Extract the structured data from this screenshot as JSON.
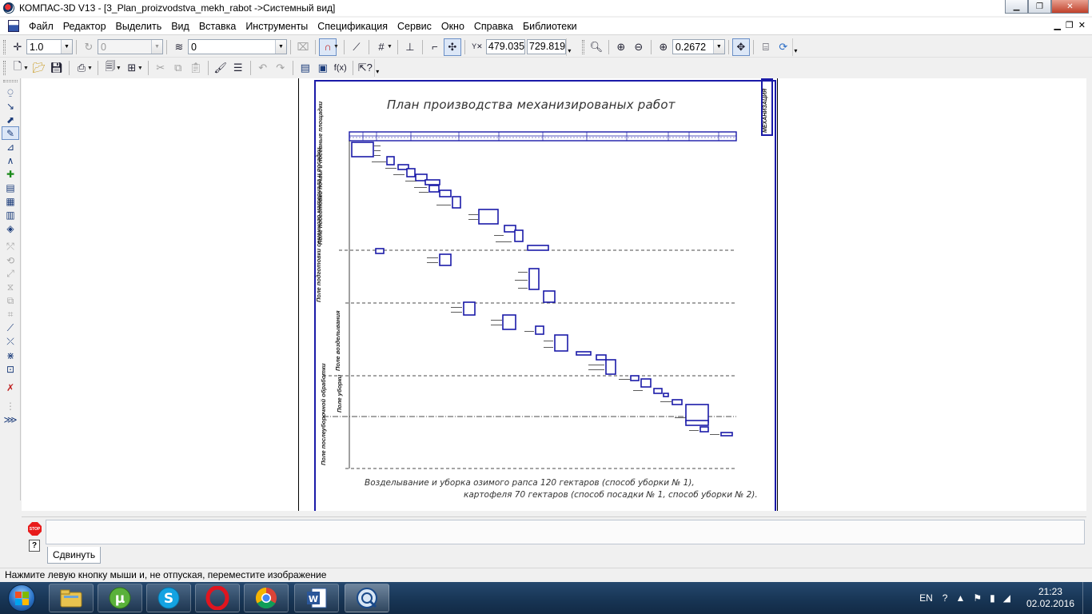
{
  "window": {
    "title": "КОМПАС-3D V13 - [3_Plan_proizvodstva_mekh_rabot ->Системный вид]"
  },
  "menu": {
    "items": [
      "Файл",
      "Редактор",
      "Выделить",
      "Вид",
      "Вставка",
      "Инструменты",
      "Спецификация",
      "Сервис",
      "Окно",
      "Справка",
      "Библиотеки"
    ]
  },
  "toolbar1": {
    "step_value": "1.0",
    "layer_value": "0",
    "style_value": "0",
    "coord_x": "479.035",
    "coord_y": "729.819",
    "zoom_value": "0.2672"
  },
  "drawing": {
    "title": "План производства механизированых работ",
    "stamp_text": "МЕХАНИЗАЦИЯ",
    "zones": [
      "Поле подготовки почвы и посевные площадки",
      "Поле подготовки семенного материала и посадки",
      "Поле возделывания",
      "Поле уборки",
      "Поле послеуборочной обработки"
    ],
    "footer_line1": "Возделывание и уборка озимого рапса 120 гектаров (способ уборки № 1),",
    "footer_line2": "картофеля 70 гектаров (способ посадки № 1, способ уборки № 2)."
  },
  "command_panel": {
    "stop_label": "STOP",
    "help_label": "?",
    "tab_label": "Сдвинуть"
  },
  "status": {
    "text": "Нажмите левую кнопку мыши и, не отпуская, переместите изображение"
  },
  "taskbar": {
    "lang": "EN",
    "time": "21:23",
    "date": "02.02.2016"
  }
}
